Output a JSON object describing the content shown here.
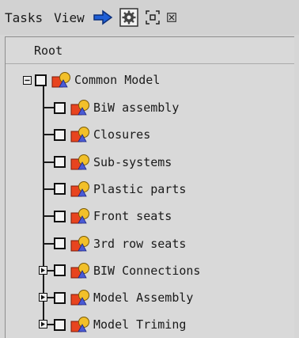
{
  "toolbar": {
    "tasks_label": "Tasks",
    "view_label": "View",
    "icons": [
      "arrow-right-icon",
      "settings-gear-icon",
      "fit-frame-icon",
      "close-small-icon"
    ]
  },
  "tree": {
    "header_label": "Root",
    "root_node": {
      "label": "Common Model",
      "expander": "minus"
    },
    "children": [
      {
        "label": "BiW assembly",
        "expander": "none"
      },
      {
        "label": "Closures",
        "expander": "none"
      },
      {
        "label": "Sub-systems",
        "expander": "none"
      },
      {
        "label": "Plastic parts",
        "expander": "none"
      },
      {
        "label": "Front seats",
        "expander": "none"
      },
      {
        "label": "3rd row seats",
        "expander": "none"
      },
      {
        "label": "BIW Connections",
        "expander": "plus"
      },
      {
        "label": "Model Assembly",
        "expander": "plus"
      },
      {
        "label": "Model Triming",
        "expander": "plus"
      }
    ]
  },
  "colors": {
    "background": "#d6d6d6",
    "part_icon_red": "#e8441f",
    "part_icon_yellow": "#f2c02a",
    "arrow_blue": "#1f5fd6"
  }
}
